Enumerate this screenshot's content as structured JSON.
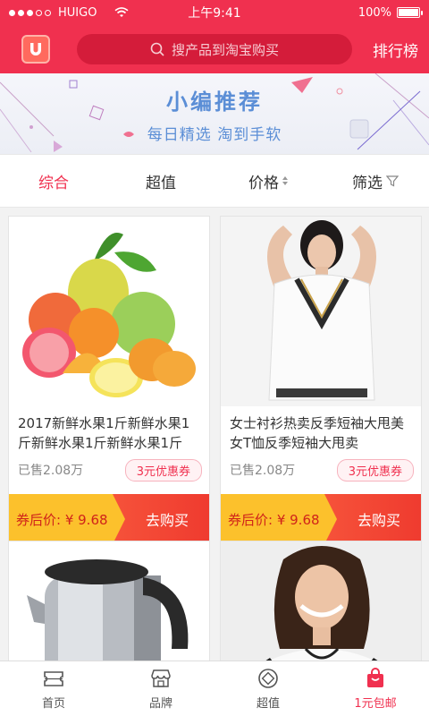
{
  "status_bar": {
    "carrier": "HUIGO",
    "time": "上午9:41",
    "battery": "100%",
    "battery_level": 1.0
  },
  "header": {
    "search_placeholder": "搜产品到淘宝购买",
    "rank_label": "排行榜",
    "logo_icon": "u-magnet-logo"
  },
  "banner": {
    "title": "小编推荐",
    "subtitle": "每日精选  淘到手软"
  },
  "tabs": [
    {
      "label": "综合",
      "active": true
    },
    {
      "label": "超值",
      "active": false
    },
    {
      "label": "价格",
      "active": false,
      "icon": "sort-icon"
    },
    {
      "label": "筛选",
      "active": false,
      "icon": "filter-icon"
    }
  ],
  "products": [
    {
      "title": "2017新鲜水果1斤新鲜水果1斤新鲜水果1斤新鲜水果1斤",
      "sold": "已售2.08万",
      "coupon": "3元优惠券",
      "price": "券后价: ¥ 9.68",
      "buy": "去购买",
      "image": "fruit-photo"
    },
    {
      "title": "女士衬衫热卖反季短袖大甩美女T恤反季短袖大甩卖",
      "sold": "已售2.08万",
      "coupon": "3元优惠券",
      "price": "券后价: ¥ 9.68",
      "buy": "去购买",
      "image": "model-photo"
    },
    {
      "image": "kettle-photo"
    },
    {
      "image": "woman-photo"
    }
  ],
  "bottom_nav": [
    {
      "label": "首页",
      "icon": "ticket-icon",
      "active": false
    },
    {
      "label": "品牌",
      "icon": "store-icon",
      "active": false
    },
    {
      "label": "超值",
      "icon": "coin-icon",
      "active": false
    },
    {
      "label": "1元包邮",
      "icon": "bag-icon",
      "active": true
    }
  ],
  "colors": {
    "brand": "#f0304f",
    "banner_text": "#5b8ed6",
    "price_bg": "#fcc12c",
    "buy_bg": "#ef3b2f"
  }
}
